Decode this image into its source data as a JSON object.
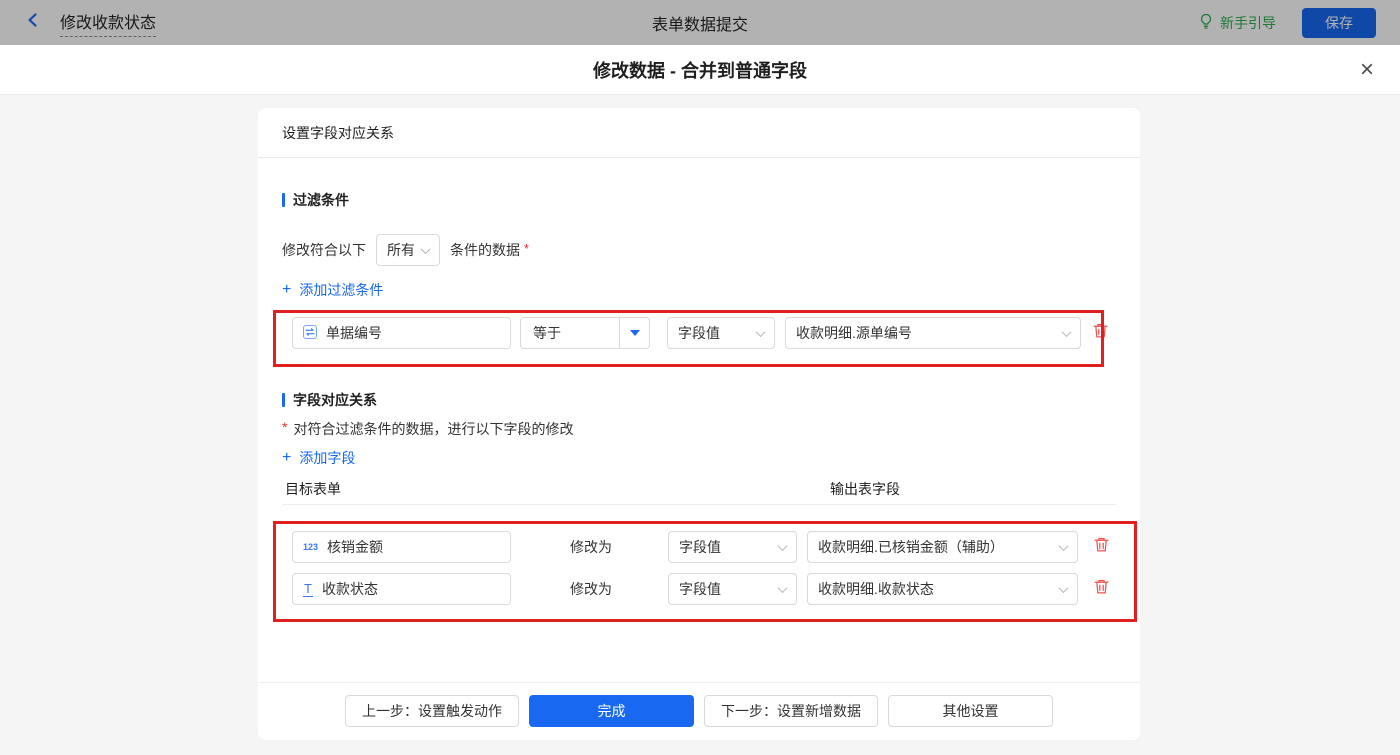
{
  "topbar": {
    "back_label": "修改收款状态",
    "center_title": "表单数据提交",
    "guide_label": "新手引导",
    "save_label": "保存"
  },
  "dialog": {
    "title": "修改数据 - 合并到普通字段",
    "close_glyph": "×"
  },
  "card": {
    "header_title": "设置字段对应关系"
  },
  "filter": {
    "section_title": "过滤条件",
    "prefix": "修改符合以下",
    "match_value": "所有",
    "suffix": "条件的数据",
    "required_mark": "*",
    "add_plus": "+",
    "add_label": "添加过滤条件",
    "row": {
      "field": "单据编号",
      "operator": "等于",
      "value_type": "字段值",
      "value": "收款明细.源单编号"
    }
  },
  "mapping": {
    "section_title": "字段对应关系",
    "required_mark": "*",
    "description": "对符合过滤条件的数据，进行以下字段的修改",
    "add_plus": "+",
    "add_label": "添加字段",
    "col_target": "目标表单",
    "col_output": "输出表字段",
    "rows": [
      {
        "icon_text": "123",
        "field": "核销金额",
        "action": "修改为",
        "value_type": "字段值",
        "value": "收款明细.已核销金额（辅助）"
      },
      {
        "icon_text": "T",
        "field": "收款状态",
        "action": "修改为",
        "value_type": "字段值",
        "value": "收款明细.收款状态"
      }
    ]
  },
  "footer": {
    "prev_label": "上一步：设置触发动作",
    "done_label": "完成",
    "next_label": "下一步：设置新增数据",
    "other_label": "其他设置"
  },
  "colors": {
    "accent_blue": "#1868f1",
    "annotation_red": "#e02020",
    "delete_red": "#ef5350",
    "guide_green": "#2fae4e",
    "required_red": "#f5222d",
    "body_gray": "#f5f5f5"
  }
}
